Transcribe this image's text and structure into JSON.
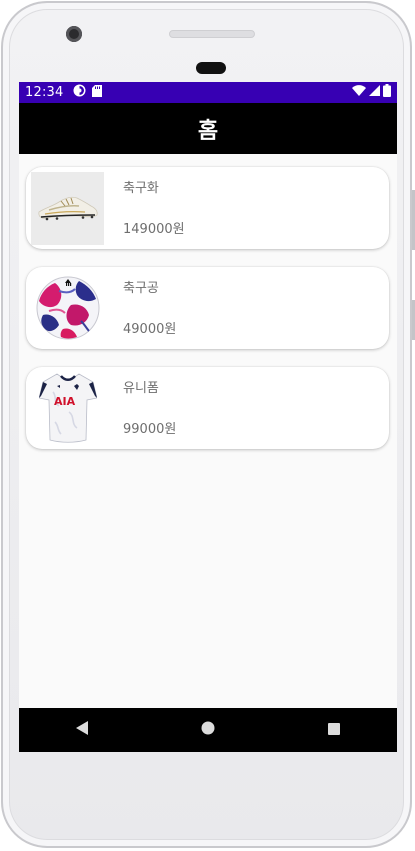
{
  "status_bar": {
    "time": "12:34"
  },
  "app_bar": {
    "title": "홈"
  },
  "products": [
    {
      "name": "축구화",
      "price": "149000원",
      "icon": "soccer-cleats-image"
    },
    {
      "name": "축구공",
      "price": "49000원",
      "icon": "soccer-ball-image"
    },
    {
      "name": "유니폼",
      "price": "99000원",
      "icon": "jersey-image"
    }
  ],
  "colors": {
    "status_bar": "#3700b3",
    "app_bar": "#000000",
    "background": "#fafafa",
    "card": "#ffffff",
    "text": "#6e6e6e"
  },
  "nav_bar": {
    "icons": [
      "back-icon",
      "home-icon",
      "recents-icon"
    ]
  }
}
